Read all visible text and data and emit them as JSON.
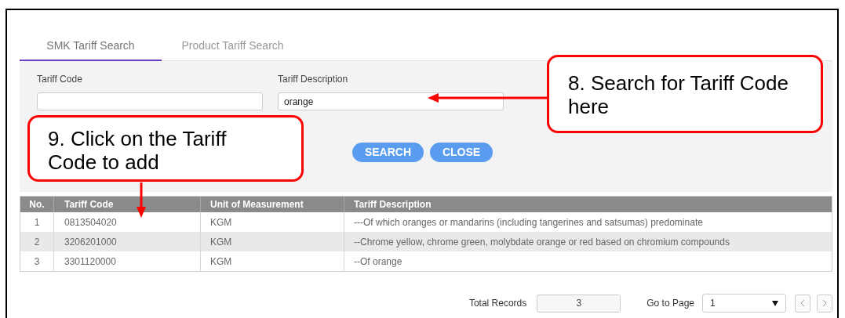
{
  "tabs": [
    {
      "label": "SMK Tariff Search",
      "selected": true
    },
    {
      "label": "Product Tariff Search",
      "selected": false
    }
  ],
  "search_form": {
    "fields": [
      {
        "label": "Tariff Code"
      },
      {
        "label": "Tariff Description",
        "value": "orange"
      }
    ],
    "buttons": [
      "SEARCH",
      "CLOSE"
    ]
  },
  "table": {
    "columns": [
      "No.",
      "Tariff Code",
      "Unit of Measurement",
      "Tariff Description"
    ],
    "rows": [
      [
        "1",
        "0813504020",
        "KGM",
        "---Of which oranges or mandarins (including tangerines and satsumas) predominate"
      ],
      [
        "2",
        "3206201000",
        "KGM",
        "--Chrome yellow, chrome green, molybdate orange or red based on chromium compounds"
      ],
      [
        "3",
        "3301120000",
        "KGM",
        "--Of orange"
      ]
    ]
  },
  "footer": {
    "total_records_label": "Total Records",
    "total_records": "3",
    "go_to_page_label": "Go to Page",
    "page": "1"
  },
  "callouts": [
    {
      "text": "8. Search for Tariff Code here"
    },
    {
      "text": "9. Click on the Tariff Code to add"
    }
  ]
}
